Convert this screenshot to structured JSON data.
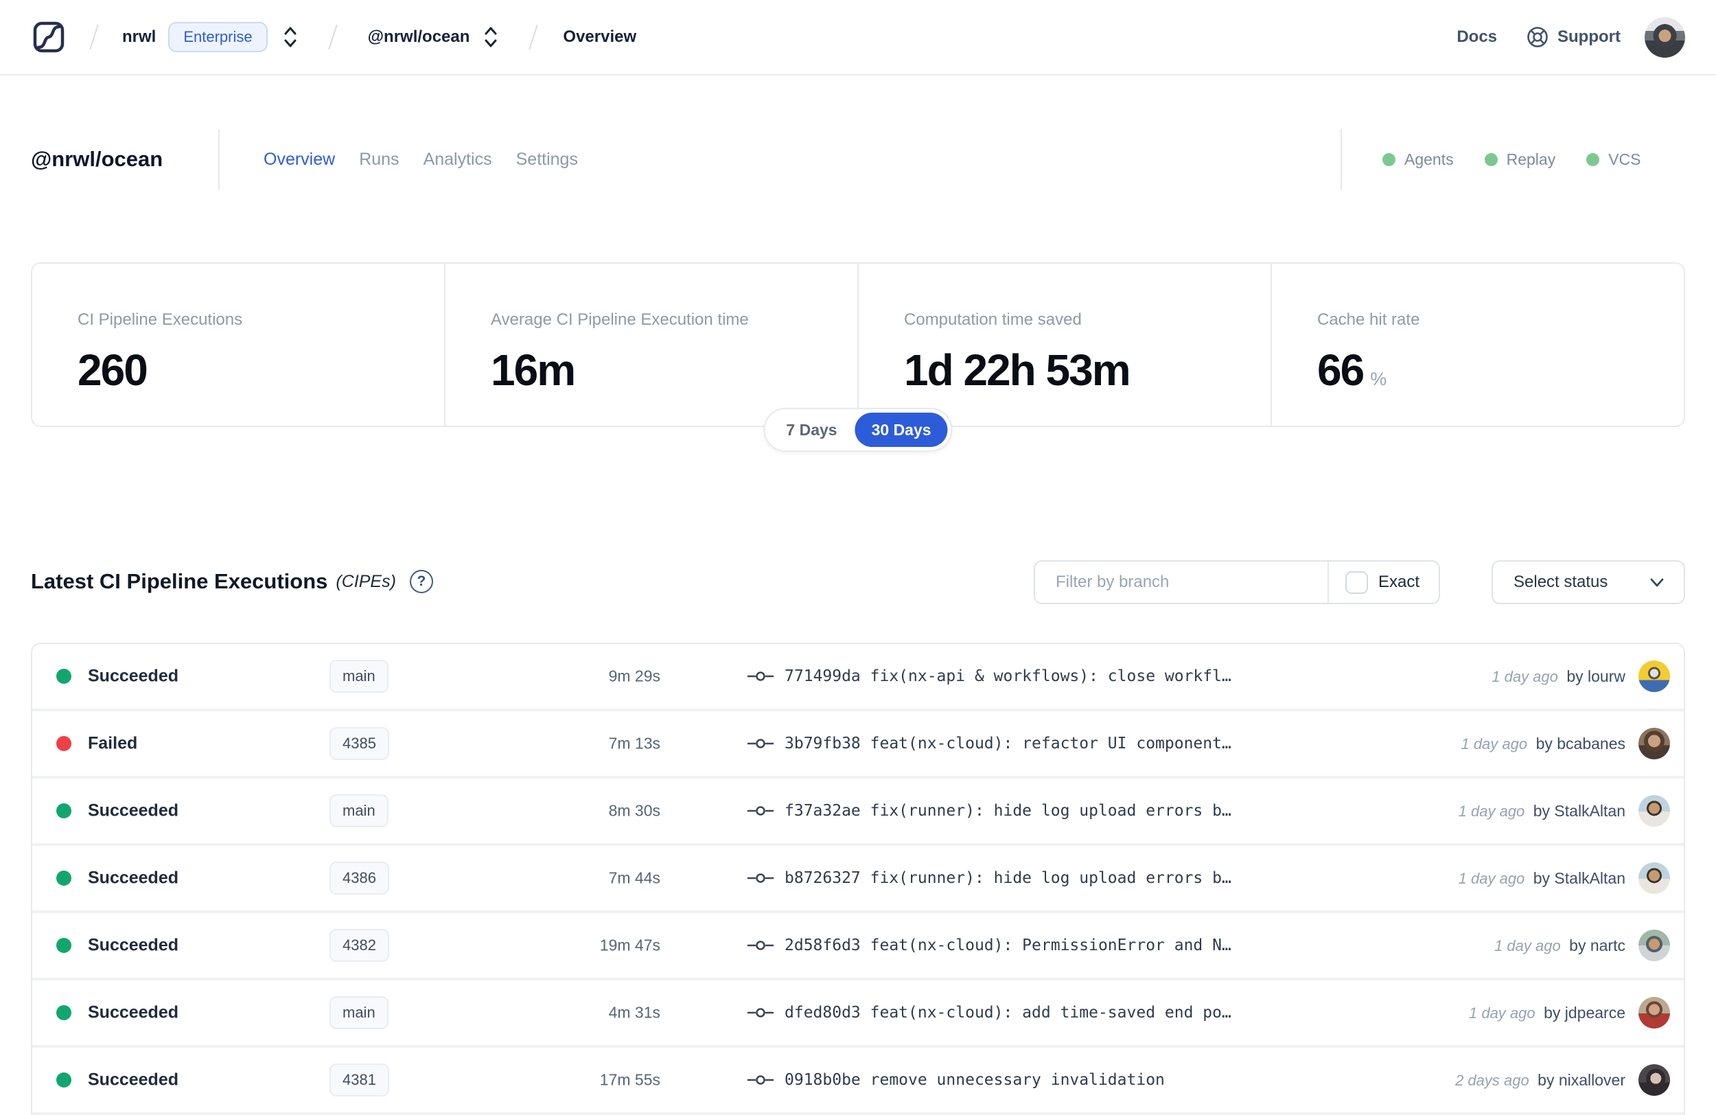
{
  "colors": {
    "accent": "#2d5cd9",
    "success": "#12a66f",
    "failure": "#ee4045",
    "feature_dot": "#7cc98f"
  },
  "header": {
    "breadcrumb": {
      "org": "nrwl",
      "org_badge": "Enterprise",
      "workspace": "@nrwl/ocean",
      "page": "Overview"
    },
    "docs_label": "Docs",
    "support_label": "Support"
  },
  "workspace": {
    "title": "@nrwl/ocean",
    "tabs": [
      {
        "label": "Overview"
      },
      {
        "label": "Runs"
      },
      {
        "label": "Analytics"
      },
      {
        "label": "Settings"
      }
    ],
    "features": [
      {
        "label": "Agents"
      },
      {
        "label": "Replay"
      },
      {
        "label": "VCS"
      }
    ]
  },
  "stats": {
    "cards": [
      {
        "label": "CI Pipeline Executions",
        "value": "260",
        "unit": ""
      },
      {
        "label": "Average CI Pipeline Execution time",
        "value": "16m",
        "unit": ""
      },
      {
        "label": "Computation time saved",
        "value": "1d 22h 53m",
        "unit": ""
      },
      {
        "label": "Cache hit rate",
        "value": "66",
        "unit": "%"
      }
    ],
    "range_toggle": {
      "options": [
        "7 Days",
        "30 Days"
      ],
      "selected": "30 Days"
    }
  },
  "cipe": {
    "title": "Latest CI Pipeline Executions",
    "title_suffix": "(CIPEs)",
    "filter": {
      "placeholder": "Filter by branch",
      "exact_label": "Exact",
      "status_label": "Select status"
    },
    "rows": [
      {
        "status": "Succeeded",
        "branch": "main",
        "duration": "9m 29s",
        "commit": "771499da fix(nx-api & workflows): close workfl…",
        "time": "1 day ago",
        "author": "by lourw"
      },
      {
        "status": "Failed",
        "branch": "4385",
        "duration": "7m 13s",
        "commit": "3b79fb38 feat(nx-cloud): refactor UI component…",
        "time": "1 day ago",
        "author": "by bcabanes"
      },
      {
        "status": "Succeeded",
        "branch": "main",
        "duration": "8m 30s",
        "commit": "f37a32ae fix(runner): hide log upload errors b…",
        "time": "1 day ago",
        "author": "by StalkAltan"
      },
      {
        "status": "Succeeded",
        "branch": "4386",
        "duration": "7m 44s",
        "commit": "b8726327 fix(runner): hide log upload errors b…",
        "time": "1 day ago",
        "author": "by StalkAltan"
      },
      {
        "status": "Succeeded",
        "branch": "4382",
        "duration": "19m 47s",
        "commit": "2d58f6d3 feat(nx-cloud): PermissionError and N…",
        "time": "1 day ago",
        "author": "by nartc"
      },
      {
        "status": "Succeeded",
        "branch": "main",
        "duration": "4m 31s",
        "commit": "dfed80d3 feat(nx-cloud): add time-saved end po…",
        "time": "1 day ago",
        "author": "by jdpearce"
      },
      {
        "status": "Succeeded",
        "branch": "4381",
        "duration": "17m 55s",
        "commit": "0918b0be remove unnecessary invalidation",
        "time": "2 days ago",
        "author": "by nixallover"
      }
    ]
  }
}
